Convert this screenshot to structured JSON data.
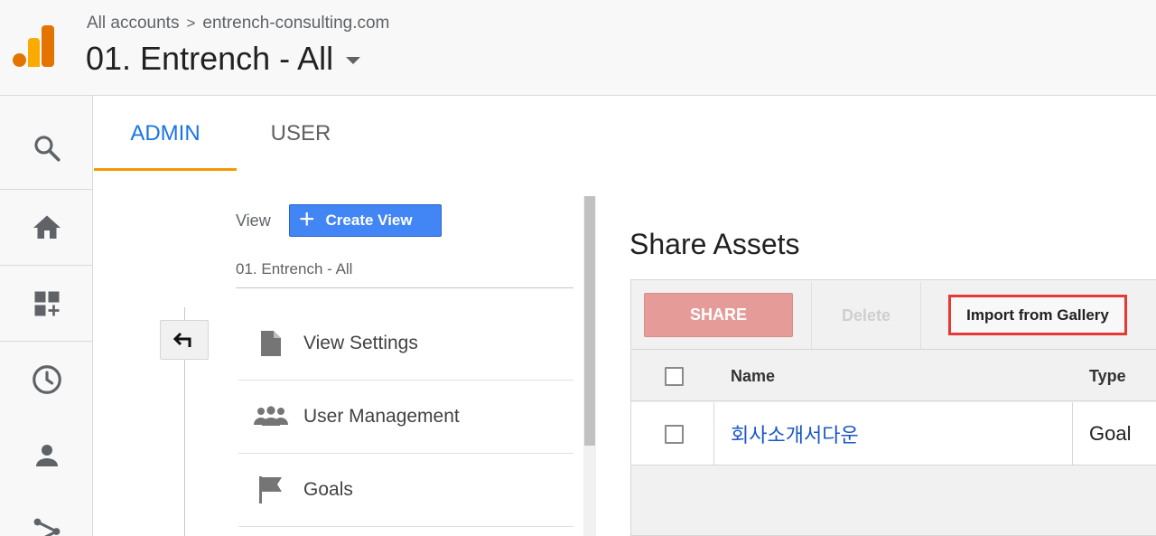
{
  "header": {
    "breadcrumb_root": "All accounts",
    "breadcrumb_separator": ">",
    "breadcrumb_property": "entrench-consulting.com",
    "view_name": "01. Entrench - All"
  },
  "rail": {
    "items": [
      "search-icon",
      "home-icon",
      "customization-icon",
      "realtime-icon",
      "audience-icon",
      "acquisition-icon"
    ]
  },
  "tabs": [
    {
      "label": "ADMIN",
      "active": true
    },
    {
      "label": "USER",
      "active": false
    }
  ],
  "admin": {
    "column_label": "View",
    "create_button": "Create View",
    "create_plus": "+",
    "selected_view": "01. Entrench - All",
    "menu": [
      {
        "label": "View Settings",
        "icon": "document-icon"
      },
      {
        "label": "User Management",
        "icon": "users-icon"
      },
      {
        "label": "Goals",
        "icon": "flag-icon"
      }
    ]
  },
  "share_assets": {
    "title": "Share Assets",
    "share_button": "SHARE",
    "delete_button": "Delete",
    "import_button": "Import from Gallery",
    "columns": [
      "Name",
      "Type"
    ],
    "rows": [
      {
        "name": "회사소개서다운",
        "type": "Goal"
      }
    ]
  },
  "colors": {
    "accent_blue": "#1a73e8",
    "tab_underline": "#f29900",
    "create_button": "#4285f4",
    "share_button": "#e59b97",
    "highlight_border": "#e53935"
  }
}
